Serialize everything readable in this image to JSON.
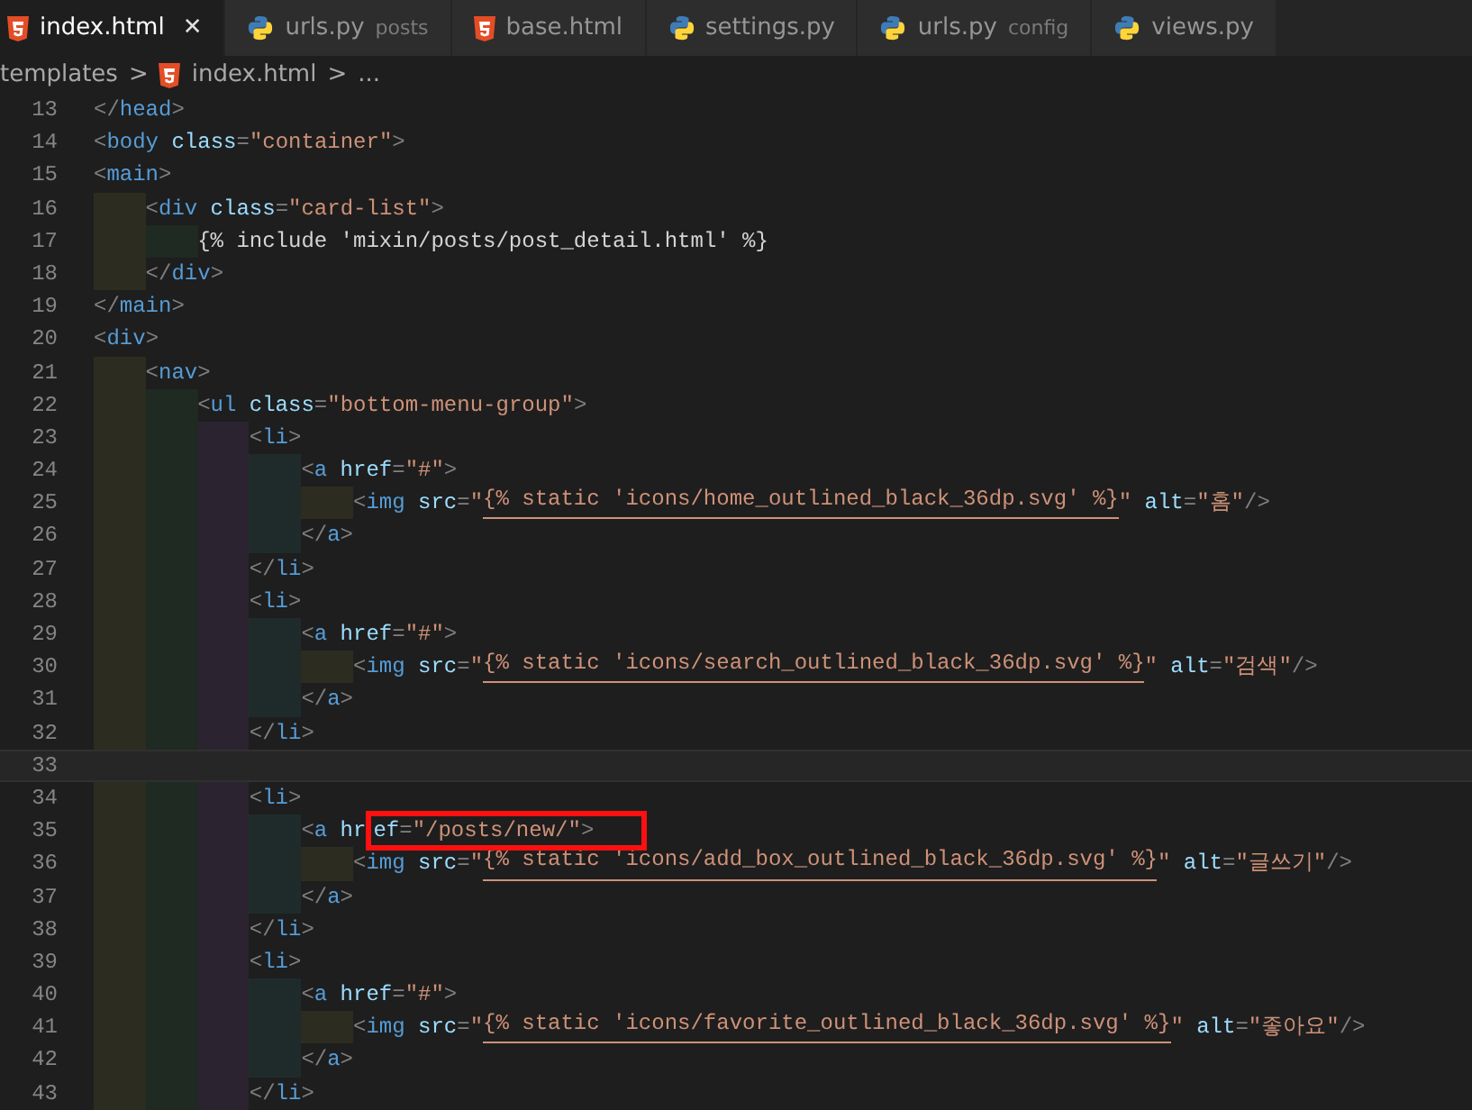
{
  "tabs": [
    {
      "kind": "html",
      "label": "index.html",
      "selected": true
    },
    {
      "kind": "python",
      "label": "urls.py",
      "description": "posts",
      "selected": false
    },
    {
      "kind": "html",
      "label": "base.html",
      "selected": false
    },
    {
      "kind": "python",
      "label": "settings.py",
      "selected": false
    },
    {
      "kind": "python",
      "label": "urls.py",
      "description": "config",
      "selected": false
    },
    {
      "kind": "python",
      "label": "views.py",
      "selected": false
    }
  ],
  "close_symbol": "✕",
  "breadcrumb": [
    {
      "kind": "folder",
      "text": "templates"
    },
    {
      "kind": "html",
      "text": "index.html"
    },
    {
      "kind": "more",
      "text": "..."
    }
  ],
  "breadcrumb_separator": ">",
  "lines": [
    {
      "number": "13",
      "current": false,
      "tokens": [
        {
          "kind": "punct",
          "text": "</"
        },
        {
          "kind": "tag",
          "text": "head"
        },
        {
          "kind": "punct",
          "text": ">"
        }
      ]
    },
    {
      "number": "14",
      "current": false,
      "tokens": [
        {
          "kind": "punct",
          "text": "<"
        },
        {
          "kind": "tag",
          "text": "body"
        },
        {
          "kind": "attr",
          "text": " class"
        },
        {
          "kind": "punct",
          "text": "="
        },
        {
          "kind": "string",
          "text": "\"container\""
        },
        {
          "kind": "punct",
          "text": ">"
        }
      ]
    },
    {
      "number": "15",
      "current": false,
      "tokens": [
        {
          "kind": "punct",
          "text": "<"
        },
        {
          "kind": "tag",
          "text": "main"
        },
        {
          "kind": "punct",
          "text": ">"
        }
      ],
      "children": [
        {
          "number": "16",
          "current": false,
          "tokens": [
            {
              "kind": "punct",
              "text": "<"
            },
            {
              "kind": "tag",
              "text": "div"
            },
            {
              "kind": "attr",
              "text": " class"
            },
            {
              "kind": "punct",
              "text": "="
            },
            {
              "kind": "string",
              "text": "\"card-list\""
            },
            {
              "kind": "punct",
              "text": ">"
            }
          ],
          "children": [
            {
              "number": "17",
              "current": false,
              "tokens": [
                {
                  "kind": "text",
                  "text": "{% include 'mixin/posts/post_detail.html' %}"
                }
              ]
            }
          ]
        },
        {
          "number": "18",
          "current": false,
          "tokens": [
            {
              "kind": "punct",
              "text": "</"
            },
            {
              "kind": "tag",
              "text": "div"
            },
            {
              "kind": "punct",
              "text": ">"
            }
          ]
        }
      ]
    },
    {
      "number": "19",
      "current": false,
      "tokens": [
        {
          "kind": "punct",
          "text": "</"
        },
        {
          "kind": "tag",
          "text": "main"
        },
        {
          "kind": "punct",
          "text": ">"
        }
      ]
    },
    {
      "number": "20",
      "current": false,
      "tokens": [
        {
          "kind": "punct",
          "text": "<"
        },
        {
          "kind": "tag",
          "text": "div"
        },
        {
          "kind": "punct",
          "text": ">"
        }
      ],
      "children": [
        {
          "number": "21",
          "current": false,
          "tokens": [
            {
              "kind": "punct",
              "text": "<"
            },
            {
              "kind": "tag",
              "text": "nav"
            },
            {
              "kind": "punct",
              "text": ">"
            }
          ],
          "children": [
            {
              "number": "22",
              "current": false,
              "tokens": [
                {
                  "kind": "punct",
                  "text": "<"
                },
                {
                  "kind": "tag",
                  "text": "ul"
                },
                {
                  "kind": "attr",
                  "text": " class"
                },
                {
                  "kind": "punct",
                  "text": "="
                },
                {
                  "kind": "string",
                  "text": "\"bottom-menu-group\""
                },
                {
                  "kind": "punct",
                  "text": ">"
                }
              ],
              "children": [
                {
                  "number": "23",
                  "current": false,
                  "tokens": [
                    {
                      "kind": "punct",
                      "text": "<"
                    },
                    {
                      "kind": "tag",
                      "text": "li"
                    },
                    {
                      "kind": "punct",
                      "text": ">"
                    }
                  ],
                  "children": [
                    {
                      "number": "24",
                      "current": false,
                      "tokens": [
                        {
                          "kind": "punct",
                          "text": "<"
                        },
                        {
                          "kind": "tag",
                          "text": "a"
                        },
                        {
                          "kind": "attr",
                          "text": " href"
                        },
                        {
                          "kind": "punct",
                          "text": "="
                        },
                        {
                          "kind": "string",
                          "text": "\"#\""
                        },
                        {
                          "kind": "punct",
                          "text": ">"
                        }
                      ],
                      "children": [
                        {
                          "number": "25",
                          "current": false,
                          "tokens": [
                            {
                              "kind": "punct",
                              "text": "<"
                            },
                            {
                              "kind": "tag",
                              "text": "img"
                            },
                            {
                              "kind": "attr",
                              "text": " src"
                            },
                            {
                              "kind": "punct",
                              "text": "="
                            },
                            {
                              "kind": "string",
                              "text": "\""
                            },
                            {
                              "kind": "template",
                              "text": "{% static 'icons/home_outlined_black_36dp.svg' %}"
                            },
                            {
                              "kind": "string",
                              "text": "\""
                            },
                            {
                              "kind": "attr",
                              "text": " alt"
                            },
                            {
                              "kind": "punct",
                              "text": "="
                            },
                            {
                              "kind": "string",
                              "text": "\"홈\""
                            },
                            {
                              "kind": "punct",
                              "text": "/>"
                            }
                          ]
                        }
                      ]
                    },
                    {
                      "number": "26",
                      "current": false,
                      "tokens": [
                        {
                          "kind": "punct",
                          "text": "</"
                        },
                        {
                          "kind": "tag",
                          "text": "a"
                        },
                        {
                          "kind": "punct",
                          "text": ">"
                        }
                      ]
                    }
                  ]
                },
                {
                  "number": "27",
                  "current": false,
                  "tokens": [
                    {
                      "kind": "punct",
                      "text": "</"
                    },
                    {
                      "kind": "tag",
                      "text": "li"
                    },
                    {
                      "kind": "punct",
                      "text": ">"
                    }
                  ]
                },
                {
                  "number": "28",
                  "current": false,
                  "tokens": [
                    {
                      "kind": "punct",
                      "text": "<"
                    },
                    {
                      "kind": "tag",
                      "text": "li"
                    },
                    {
                      "kind": "punct",
                      "text": ">"
                    }
                  ],
                  "children": [
                    {
                      "number": "29",
                      "current": false,
                      "tokens": [
                        {
                          "kind": "punct",
                          "text": "<"
                        },
                        {
                          "kind": "tag",
                          "text": "a"
                        },
                        {
                          "kind": "attr",
                          "text": " href"
                        },
                        {
                          "kind": "punct",
                          "text": "="
                        },
                        {
                          "kind": "string",
                          "text": "\"#\""
                        },
                        {
                          "kind": "punct",
                          "text": ">"
                        }
                      ],
                      "children": [
                        {
                          "number": "30",
                          "current": false,
                          "tokens": [
                            {
                              "kind": "punct",
                              "text": "<"
                            },
                            {
                              "kind": "tag",
                              "text": "img"
                            },
                            {
                              "kind": "attr",
                              "text": " src"
                            },
                            {
                              "kind": "punct",
                              "text": "="
                            },
                            {
                              "kind": "string",
                              "text": "\""
                            },
                            {
                              "kind": "template",
                              "text": "{% static 'icons/search_outlined_black_36dp.svg' %}"
                            },
                            {
                              "kind": "string",
                              "text": "\""
                            },
                            {
                              "kind": "attr",
                              "text": " alt"
                            },
                            {
                              "kind": "punct",
                              "text": "="
                            },
                            {
                              "kind": "string",
                              "text": "\"검색\""
                            },
                            {
                              "kind": "punct",
                              "text": "/>"
                            }
                          ]
                        }
                      ]
                    },
                    {
                      "number": "31",
                      "current": false,
                      "tokens": [
                        {
                          "kind": "punct",
                          "text": "</"
                        },
                        {
                          "kind": "tag",
                          "text": "a"
                        },
                        {
                          "kind": "punct",
                          "text": ">"
                        }
                      ]
                    }
                  ]
                },
                {
                  "number": "32",
                  "current": false,
                  "tokens": [
                    {
                      "kind": "punct",
                      "text": "</"
                    },
                    {
                      "kind": "tag",
                      "text": "li"
                    },
                    {
                      "kind": "punct",
                      "text": ">"
                    }
                  ]
                },
                {
                  "number": "33",
                  "current": true
                },
                {
                  "number": "34",
                  "current": false,
                  "tokens": [
                    {
                      "kind": "punct",
                      "text": "<"
                    },
                    {
                      "kind": "tag",
                      "text": "li"
                    },
                    {
                      "kind": "punct",
                      "text": ">"
                    }
                  ],
                  "children": [
                    {
                      "number": "35",
                      "current": false,
                      "tokens": [
                        {
                          "kind": "punct",
                          "text": "<"
                        },
                        {
                          "kind": "tag",
                          "text": "a"
                        },
                        {
                          "kind": "attr",
                          "text": " hr"
                        }
                      ],
                      "boxed_tokens": [
                        {
                          "kind": "attr",
                          "text": "ef"
                        },
                        {
                          "kind": "punct",
                          "text": "="
                        },
                        {
                          "kind": "string",
                          "text": "\"/posts/new/\""
                        },
                        {
                          "kind": "punct",
                          "text": ">"
                        }
                      ],
                      "children": [
                        {
                          "number": "36",
                          "current": false,
                          "tokens": [
                            {
                              "kind": "punct",
                              "text": "<"
                            },
                            {
                              "kind": "tag",
                              "text": "img"
                            },
                            {
                              "kind": "attr",
                              "text": " src"
                            },
                            {
                              "kind": "punct",
                              "text": "="
                            },
                            {
                              "kind": "string",
                              "text": "\""
                            },
                            {
                              "kind": "template",
                              "text": "{% static 'icons/add_box_outlined_black_36dp.svg' %}"
                            },
                            {
                              "kind": "string",
                              "text": "\""
                            },
                            {
                              "kind": "attr",
                              "text": " alt"
                            },
                            {
                              "kind": "punct",
                              "text": "="
                            },
                            {
                              "kind": "string",
                              "text": "\"글쓰기\""
                            },
                            {
                              "kind": "punct",
                              "text": "/>"
                            }
                          ]
                        }
                      ]
                    },
                    {
                      "number": "37",
                      "current": false,
                      "tokens": [
                        {
                          "kind": "punct",
                          "text": "</"
                        },
                        {
                          "kind": "tag",
                          "text": "a"
                        },
                        {
                          "kind": "punct",
                          "text": ">"
                        }
                      ]
                    }
                  ]
                },
                {
                  "number": "38",
                  "current": false,
                  "tokens": [
                    {
                      "kind": "punct",
                      "text": "</"
                    },
                    {
                      "kind": "tag",
                      "text": "li"
                    },
                    {
                      "kind": "punct",
                      "text": ">"
                    }
                  ]
                },
                {
                  "number": "39",
                  "current": false,
                  "tokens": [
                    {
                      "kind": "punct",
                      "text": "<"
                    },
                    {
                      "kind": "tag",
                      "text": "li"
                    },
                    {
                      "kind": "punct",
                      "text": ">"
                    }
                  ],
                  "children": [
                    {
                      "number": "40",
                      "current": false,
                      "tokens": [
                        {
                          "kind": "punct",
                          "text": "<"
                        },
                        {
                          "kind": "tag",
                          "text": "a"
                        },
                        {
                          "kind": "attr",
                          "text": " href"
                        },
                        {
                          "kind": "punct",
                          "text": "="
                        },
                        {
                          "kind": "string",
                          "text": "\"#\""
                        },
                        {
                          "kind": "punct",
                          "text": ">"
                        }
                      ],
                      "children": [
                        {
                          "number": "41",
                          "current": false,
                          "tokens": [
                            {
                              "kind": "punct",
                              "text": "<"
                            },
                            {
                              "kind": "tag",
                              "text": "img"
                            },
                            {
                              "kind": "attr",
                              "text": " src"
                            },
                            {
                              "kind": "punct",
                              "text": "="
                            },
                            {
                              "kind": "string",
                              "text": "\""
                            },
                            {
                              "kind": "template",
                              "text": "{% static 'icons/favorite_outlined_black_36dp.svg' %}"
                            },
                            {
                              "kind": "string",
                              "text": "\""
                            },
                            {
                              "kind": "attr",
                              "text": " alt"
                            },
                            {
                              "kind": "punct",
                              "text": "="
                            },
                            {
                              "kind": "string",
                              "text": "\"좋아요\""
                            },
                            {
                              "kind": "punct",
                              "text": "/>"
                            }
                          ]
                        }
                      ]
                    },
                    {
                      "number": "42",
                      "current": false,
                      "tokens": [
                        {
                          "kind": "punct",
                          "text": "</"
                        },
                        {
                          "kind": "tag",
                          "text": "a"
                        },
                        {
                          "kind": "punct",
                          "text": ">"
                        }
                      ]
                    }
                  ]
                },
                {
                  "number": "43",
                  "current": false,
                  "tokens": [
                    {
                      "kind": "punct",
                      "text": "</"
                    },
                    {
                      "kind": "tag",
                      "text": "li"
                    },
                    {
                      "kind": "punct",
                      "text": ">"
                    }
                  ]
                }
              ]
            }
          ]
        }
      ]
    }
  ]
}
